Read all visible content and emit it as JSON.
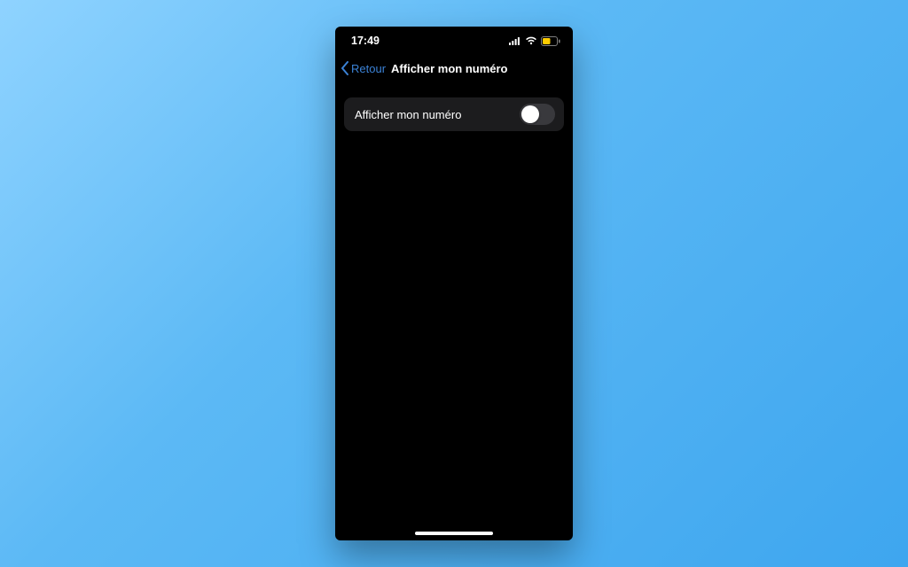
{
  "status": {
    "time": "17:49"
  },
  "nav": {
    "back_label": "Retour",
    "title": "Afficher mon numéro"
  },
  "settings": {
    "show_my_number": {
      "label": "Afficher mon numéro",
      "value": false
    }
  }
}
